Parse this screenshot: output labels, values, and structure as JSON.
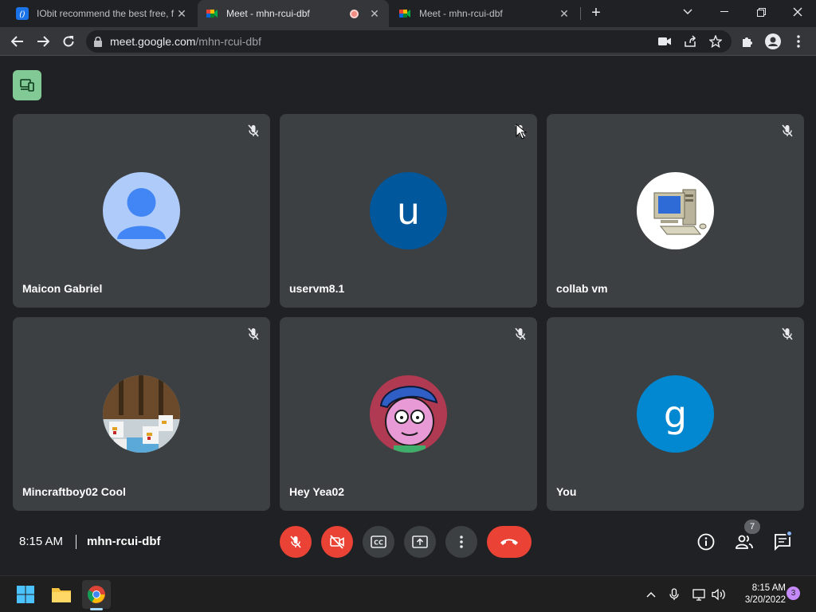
{
  "browser": {
    "tabs": [
      {
        "title": "IObit recommend the best free, f",
        "favicon": "iobit-icon"
      },
      {
        "title": "Meet - mhn-rcui-dbf",
        "favicon": "meet-icon",
        "active": true,
        "recording": true
      },
      {
        "title": "Meet - mhn-rcui-dbf",
        "favicon": "meet-icon"
      }
    ],
    "url_host": "meet.google.com",
    "url_path": "/mhn-rcui-dbf"
  },
  "meet": {
    "participants": [
      {
        "name": "Maicon Gabriel",
        "avatar": "default-person-icon"
      },
      {
        "name": "uservm8.1",
        "avatar_letter": "u",
        "color": "#01579b"
      },
      {
        "name": "collab vm",
        "avatar": "computer-picture"
      },
      {
        "name": "Mincraftboy02 Cool",
        "avatar": "minecraft-chickens-picture"
      },
      {
        "name": "Hey Yea02",
        "avatar": "cartoon-character-picture"
      },
      {
        "name": "You",
        "avatar_letter": "g",
        "color": "#0288d1"
      }
    ],
    "time": "8:15 AM",
    "meeting_code": "mhn-rcui-dbf",
    "people_count": "7"
  },
  "taskbar": {
    "time": "8:15 AM",
    "date": "3/20/2022",
    "notifications": "3"
  },
  "colors": {
    "tile": "#3c4043",
    "danger": "#ea4335",
    "companion": "#81c995"
  }
}
